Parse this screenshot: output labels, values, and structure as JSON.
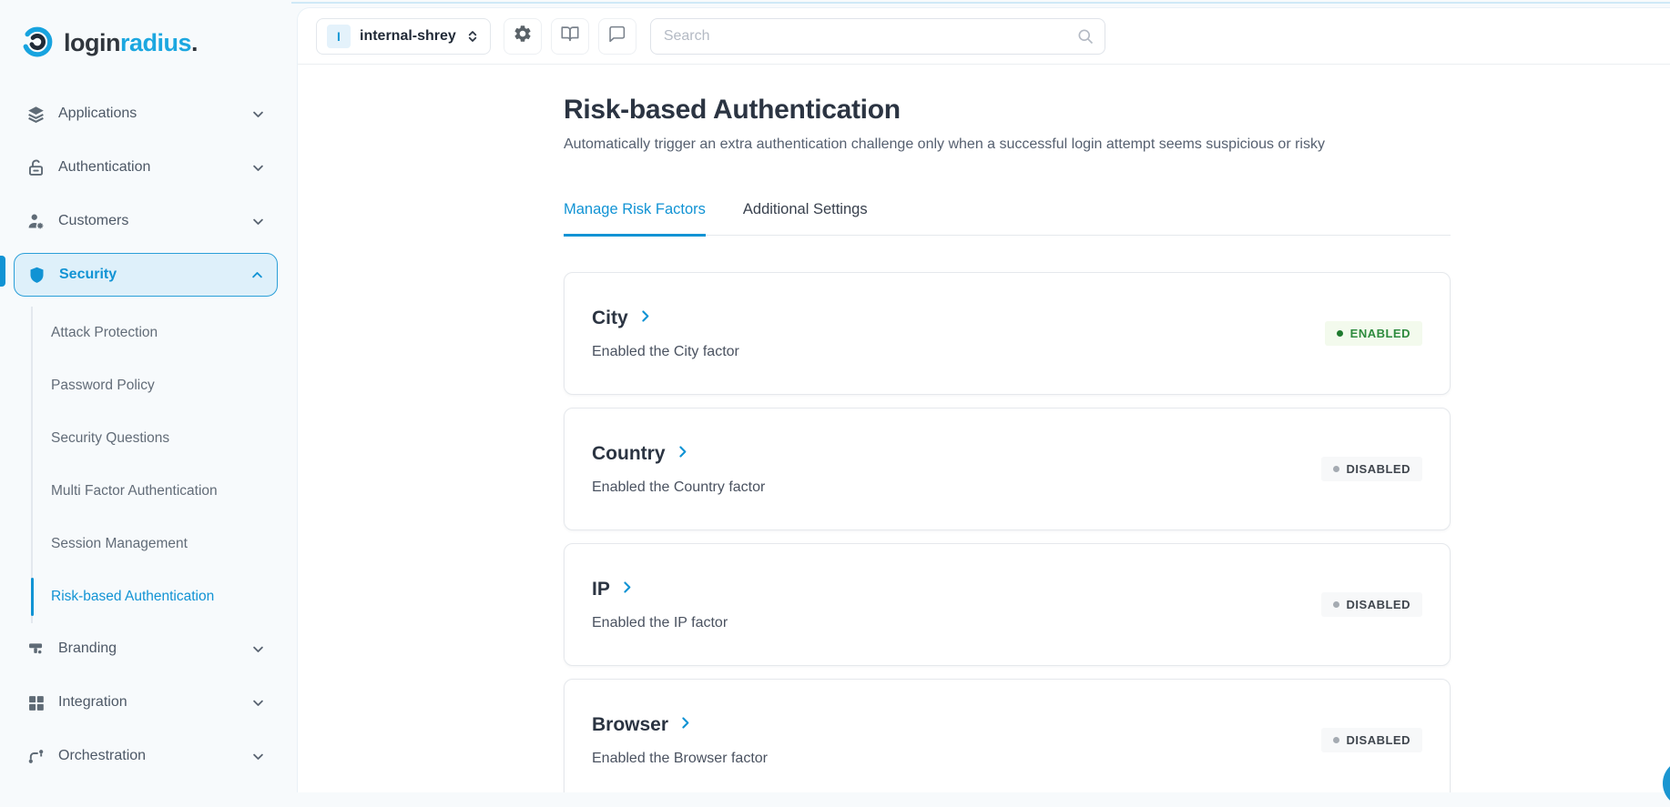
{
  "brand": {
    "word_primary": "login",
    "word_secondary": "radius",
    "word_suffix": "."
  },
  "sidebar": {
    "items": [
      {
        "label": "Applications",
        "icon": "layers-icon",
        "expandable": true
      },
      {
        "label": "Authentication",
        "icon": "unlock-icon",
        "expandable": true
      },
      {
        "label": "Customers",
        "icon": "user-settings-icon",
        "expandable": true
      },
      {
        "label": "Security",
        "icon": "shield-icon",
        "expandable": true,
        "expanded": true,
        "active": true,
        "children": [
          {
            "label": "Attack Protection",
            "active": false
          },
          {
            "label": "Password Policy",
            "active": false
          },
          {
            "label": "Security Questions",
            "active": false
          },
          {
            "label": "Multi Factor Authentication",
            "active": false
          },
          {
            "label": "Session Management",
            "active": false
          },
          {
            "label": "Risk-based Authentication",
            "active": true
          }
        ]
      },
      {
        "label": "Branding",
        "icon": "paint-roller-icon",
        "expandable": true
      },
      {
        "label": "Integration",
        "icon": "grid-icon",
        "expandable": true
      },
      {
        "label": "Orchestration",
        "icon": "branch-icon",
        "expandable": true
      }
    ]
  },
  "topbar": {
    "app_initial": "I",
    "app_name": "internal-shrey",
    "search_placeholder": "Search"
  },
  "page": {
    "title": "Risk-based Authentication",
    "subtitle": "Automatically trigger an extra authentication challenge only when a successful login attempt seems suspicious or risky"
  },
  "tabs": [
    {
      "label": "Manage Risk Factors",
      "active": true
    },
    {
      "label": "Additional Settings",
      "active": false
    }
  ],
  "cards": [
    {
      "title": "City",
      "description": "Enabled the City factor",
      "status": "ENABLED"
    },
    {
      "title": "Country",
      "description": "Enabled the Country factor",
      "status": "DISABLED"
    },
    {
      "title": "IP",
      "description": "Enabled the IP factor",
      "status": "DISABLED"
    },
    {
      "title": "Browser",
      "description": "Enabled the Browser factor",
      "status": "DISABLED"
    }
  ],
  "colors": {
    "accent_blue": "#1193d4",
    "logo_blue": "#1ca7e0",
    "active_item_bg": "#def0fa",
    "active_item_border": "#2a9fd8",
    "enabled_green": "#2e8b3e",
    "enabled_badge_bg": "#f3faed",
    "disabled_badge_bg": "#f7f8f9",
    "sidebar_bg": "#f7fafc"
  }
}
